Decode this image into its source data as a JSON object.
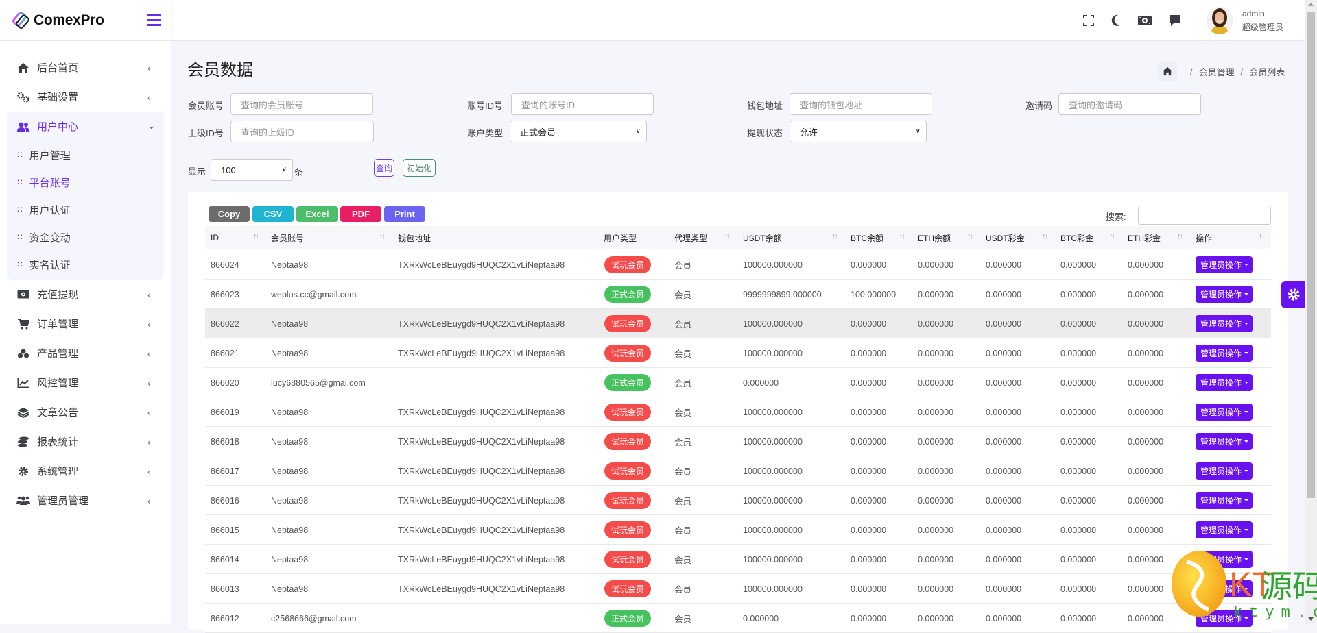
{
  "app": {
    "name": "ComexPro"
  },
  "sidebar": {
    "items": [
      {
        "label": "后台首页",
        "icon": "home-icon"
      },
      {
        "label": "基础设置",
        "icon": "cogs-icon"
      }
    ],
    "open_group": {
      "label": "用户中心",
      "icon": "users-icon",
      "children": [
        {
          "label": "用户管理",
          "active": false
        },
        {
          "label": "平台账号",
          "active": true
        },
        {
          "label": "用户认证",
          "active": false
        },
        {
          "label": "资金变动",
          "active": false
        },
        {
          "label": "实名认证",
          "active": false
        }
      ]
    },
    "items_after": [
      {
        "label": "充值提现",
        "icon": "money-icon"
      },
      {
        "label": "订单管理",
        "icon": "cart-icon"
      },
      {
        "label": "产品管理",
        "icon": "cubes-icon"
      },
      {
        "label": "风控管理",
        "icon": "chart-line-icon"
      },
      {
        "label": "文章公告",
        "icon": "layers-icon"
      },
      {
        "label": "报表统计",
        "icon": "database-icon"
      },
      {
        "label": "系统管理",
        "icon": "gear-icon"
      },
      {
        "label": "管理员管理",
        "icon": "user-group-icon"
      }
    ]
  },
  "header": {
    "icons": [
      "fullscreen-icon",
      "moon-icon",
      "money-icon",
      "chat-icon"
    ],
    "user": {
      "name": "admin",
      "role": "超级管理员"
    }
  },
  "page": {
    "title": "会员数据",
    "breadcrumb": [
      "会员管理",
      "会员列表"
    ]
  },
  "filters": {
    "member_account": {
      "label": "会员账号",
      "placeholder": "查询的会员账号"
    },
    "account_id": {
      "label": "账号ID号",
      "placeholder": "查询的账号ID"
    },
    "wallet": {
      "label": "钱包地址",
      "placeholder": "查询的钱包地址"
    },
    "invite": {
      "label": "邀请码",
      "placeholder": "查询的邀请码"
    },
    "parent_id": {
      "label": "上级ID号",
      "placeholder": "查询的上级ID"
    },
    "account_type": {
      "label": "账户类型",
      "value": "正式会员"
    },
    "withdraw_status": {
      "label": "提现状态",
      "value": "允许"
    },
    "show": {
      "label": "显示",
      "value": "100",
      "suffix": "条"
    },
    "query_button": "查询",
    "reset_button": "初始化"
  },
  "table": {
    "export_buttons": [
      {
        "label": "Copy",
        "color": "#6c6c6c"
      },
      {
        "label": "CSV",
        "color": "#1fb5d1"
      },
      {
        "label": "Excel",
        "color": "#4cbd6a"
      },
      {
        "label": "PDF",
        "color": "#ea1f63"
      },
      {
        "label": "Print",
        "color": "#6a64f1"
      }
    ],
    "search_label": "搜索:",
    "search_value": "",
    "columns": [
      "ID",
      "会员账号",
      "钱包地址",
      "用户类型",
      "代理类型",
      "USDT余额",
      "BTC余额",
      "ETH余额",
      "USDT彩金",
      "BTC彩金",
      "ETH彩金",
      "操作"
    ],
    "badge_colors": {
      "试玩会员": "#f44b4b",
      "正式会员": "#46c35f"
    },
    "action_label": "管理员操作",
    "highlight_row": 2,
    "rows": [
      {
        "id": "866024",
        "account": "Neptaa98",
        "wallet": "TXRkWcLeBEuygd9HUQC2X1vLiNeptaa98",
        "user_type": "试玩会员",
        "agent_type": "会员",
        "usdt": "100000.000000",
        "btc": "0.000000",
        "eth": "0.000000",
        "usdt_bonus": "0.000000",
        "btc_bonus": "0.000000",
        "eth_bonus": "0.000000"
      },
      {
        "id": "866023",
        "account": "weplus.cc@gmail.com",
        "wallet": "",
        "user_type": "正式会员",
        "agent_type": "会员",
        "usdt": "9999999899.000000",
        "btc": "100.000000",
        "eth": "0.000000",
        "usdt_bonus": "0.000000",
        "btc_bonus": "0.000000",
        "eth_bonus": "0.000000"
      },
      {
        "id": "866022",
        "account": "Neptaa98",
        "wallet": "TXRkWcLeBEuygd9HUQC2X1vLiNeptaa98",
        "user_type": "试玩会员",
        "agent_type": "会员",
        "usdt": "100000.000000",
        "btc": "0.000000",
        "eth": "0.000000",
        "usdt_bonus": "0.000000",
        "btc_bonus": "0.000000",
        "eth_bonus": "0.000000"
      },
      {
        "id": "866021",
        "account": "Neptaa98",
        "wallet": "TXRkWcLeBEuygd9HUQC2X1vLiNeptaa98",
        "user_type": "试玩会员",
        "agent_type": "会员",
        "usdt": "100000.000000",
        "btc": "0.000000",
        "eth": "0.000000",
        "usdt_bonus": "0.000000",
        "btc_bonus": "0.000000",
        "eth_bonus": "0.000000"
      },
      {
        "id": "866020",
        "account": "lucy6880565@gmai.com",
        "wallet": "",
        "user_type": "正式会员",
        "agent_type": "会员",
        "usdt": "0.000000",
        "btc": "0.000000",
        "eth": "0.000000",
        "usdt_bonus": "0.000000",
        "btc_bonus": "0.000000",
        "eth_bonus": "0.000000"
      },
      {
        "id": "866019",
        "account": "Neptaa98",
        "wallet": "TXRkWcLeBEuygd9HUQC2X1vLiNeptaa98",
        "user_type": "试玩会员",
        "agent_type": "会员",
        "usdt": "100000.000000",
        "btc": "0.000000",
        "eth": "0.000000",
        "usdt_bonus": "0.000000",
        "btc_bonus": "0.000000",
        "eth_bonus": "0.000000"
      },
      {
        "id": "866018",
        "account": "Neptaa98",
        "wallet": "TXRkWcLeBEuygd9HUQC2X1vLiNeptaa98",
        "user_type": "试玩会员",
        "agent_type": "会员",
        "usdt": "100000.000000",
        "btc": "0.000000",
        "eth": "0.000000",
        "usdt_bonus": "0.000000",
        "btc_bonus": "0.000000",
        "eth_bonus": "0.000000"
      },
      {
        "id": "866017",
        "account": "Neptaa98",
        "wallet": "TXRkWcLeBEuygd9HUQC2X1vLiNeptaa98",
        "user_type": "试玩会员",
        "agent_type": "会员",
        "usdt": "100000.000000",
        "btc": "0.000000",
        "eth": "0.000000",
        "usdt_bonus": "0.000000",
        "btc_bonus": "0.000000",
        "eth_bonus": "0.000000"
      },
      {
        "id": "866016",
        "account": "Neptaa98",
        "wallet": "TXRkWcLeBEuygd9HUQC2X1vLiNeptaa98",
        "user_type": "试玩会员",
        "agent_type": "会员",
        "usdt": "100000.000000",
        "btc": "0.000000",
        "eth": "0.000000",
        "usdt_bonus": "0.000000",
        "btc_bonus": "0.000000",
        "eth_bonus": "0.000000"
      },
      {
        "id": "866015",
        "account": "Neptaa98",
        "wallet": "TXRkWcLeBEuygd9HUQC2X1vLiNeptaa98",
        "user_type": "试玩会员",
        "agent_type": "会员",
        "usdt": "100000.000000",
        "btc": "0.000000",
        "eth": "0.000000",
        "usdt_bonus": "0.000000",
        "btc_bonus": "0.000000",
        "eth_bonus": "0.000000"
      },
      {
        "id": "866014",
        "account": "Neptaa98",
        "wallet": "TXRkWcLeBEuygd9HUQC2X1vLiNeptaa98",
        "user_type": "试玩会员",
        "agent_type": "会员",
        "usdt": "100000.000000",
        "btc": "0.000000",
        "eth": "0.000000",
        "usdt_bonus": "0.000000",
        "btc_bonus": "0.000000",
        "eth_bonus": "0.000000"
      },
      {
        "id": "866013",
        "account": "Neptaa98",
        "wallet": "TXRkWcLeBEuygd9HUQC2X1vLiNeptaa98",
        "user_type": "试玩会员",
        "agent_type": "会员",
        "usdt": "100000.000000",
        "btc": "0.000000",
        "eth": "0.000000",
        "usdt_bonus": "0.000000",
        "btc_bonus": "0.000000",
        "eth_bonus": "0.000000"
      },
      {
        "id": "866012",
        "account": "c2568666@gmail.com",
        "wallet": "",
        "user_type": "正式会员",
        "agent_type": "会员",
        "usdt": "0.000000",
        "btc": "0.000000",
        "eth": "0.000000",
        "usdt_bonus": "0.000000",
        "btc_bonus": "0.000000",
        "eth_bonus": "0.000000"
      }
    ]
  },
  "watermark": {
    "brand": "KT源码",
    "site": "ktym.com"
  },
  "colors": {
    "accent": "#6b2bea",
    "action": "#6a11f0"
  }
}
